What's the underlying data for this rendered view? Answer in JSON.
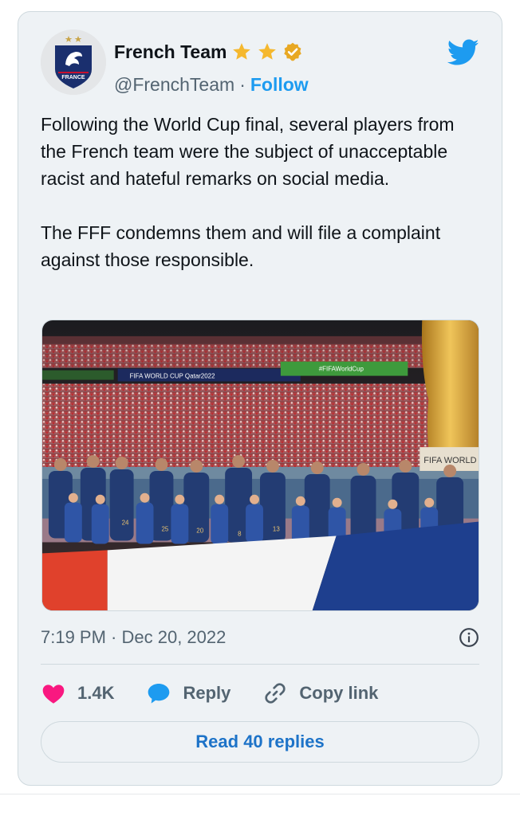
{
  "author": {
    "display_name": "French Team",
    "handle": "@FrenchTeam",
    "separator": "·",
    "follow_label": "Follow",
    "avatar_text": "FRANCE",
    "badges": [
      "star-icon",
      "star-icon",
      "verified-badge-icon"
    ]
  },
  "tweet": {
    "text": "Following the World Cup final, several players from the French team were the subject of unacceptable racist and hateful remarks on social media.\n\nThe FFF condemns them and will file a complaint against those responsible.",
    "timestamp": "7:19 PM · Dec 20, 2022"
  },
  "media": {
    "description_icon": "team-photo",
    "stadium_banner_1": "FIFA WORLD CUP Qatar2022",
    "stadium_banner_2": "#FIFAWorldCup",
    "trophy_banner": "FIFA WORLD CUP",
    "shirt_numbers": [
      "24",
      "25",
      "20",
      "8",
      "13"
    ]
  },
  "actions": {
    "like_count": "1.4K",
    "reply_label": "Reply",
    "copy_link_label": "Copy link"
  },
  "read_replies_label": "Read 40 replies",
  "colors": {
    "accent": "#1d9bf0",
    "like": "#f91880",
    "card_bg": "#eef2f5",
    "star": "#f5b82e"
  }
}
